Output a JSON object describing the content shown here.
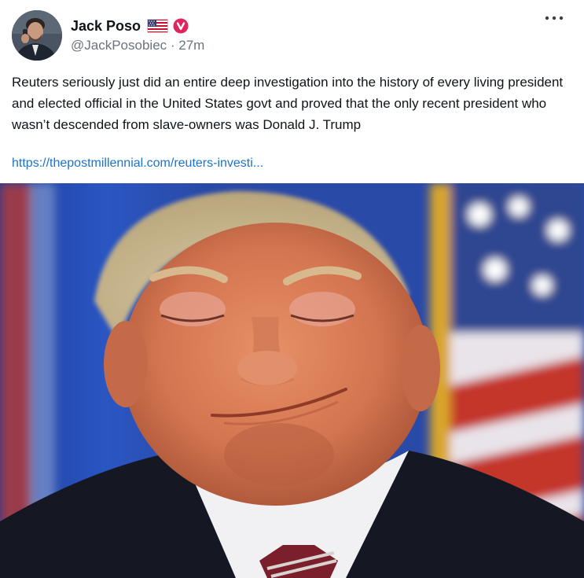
{
  "post": {
    "author": {
      "display_name": "Jack Poso",
      "flag_icon": "us-flag-icon",
      "verified_icon": "verified-badge-icon",
      "handle": "@JackPosobiec",
      "separator": " · ",
      "time_ago": "27m"
    },
    "more_icon": "more-horizontal-icon",
    "text": "Reuters seriously just did an entire deep investigation into the history of every living president and elected official in the United States govt and proved that the only recent president who wasn’t descended from slave-owners was Donald J. Trump",
    "link_text": "https://thepostmillennial.com/reuters-investi...",
    "colors": {
      "link": "#1d73c9",
      "verified_badge": "#e0245e",
      "text": "#0f1419",
      "muted": "#6b737c"
    }
  }
}
